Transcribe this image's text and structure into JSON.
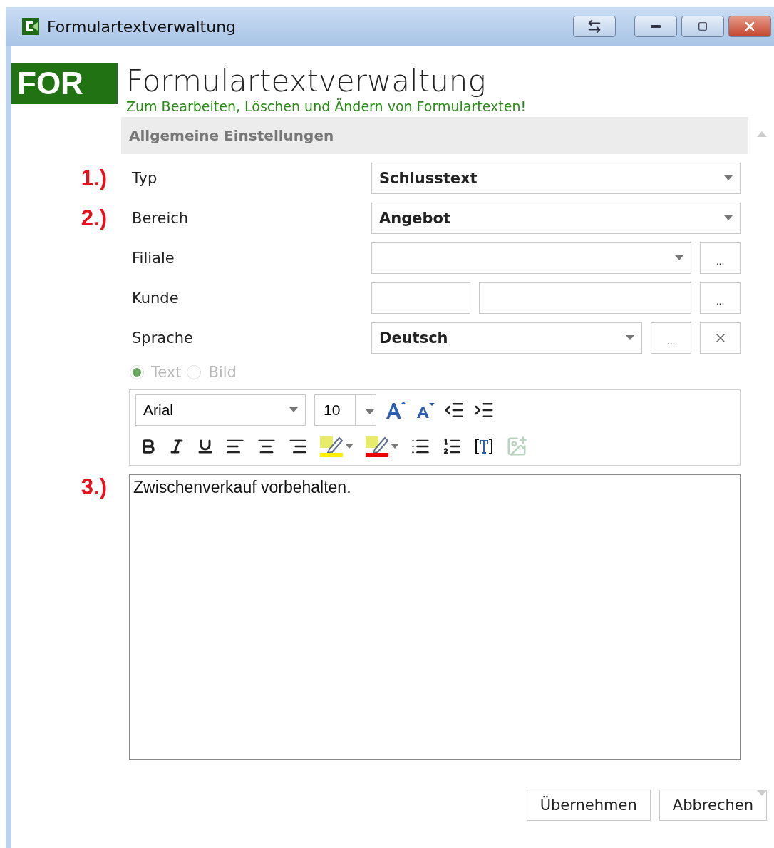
{
  "window": {
    "title": "Formulartextverwaltung"
  },
  "header": {
    "logo": "FOR",
    "title": "Formulartextverwaltung",
    "subtitle": "Zum Bearbeiten, Löschen und Ändern von Formulartexten!"
  },
  "section": {
    "title": "Allgemeine Einstellungen"
  },
  "fields": [
    {
      "kind": "select",
      "marker": "1.)",
      "label": "Typ",
      "value": "Schlusstext"
    },
    {
      "kind": "select",
      "marker": "2.)",
      "label": "Bereich",
      "value": "Angebot"
    },
    {
      "kind": "select-browse",
      "label": "Filiale",
      "browse": "..."
    },
    {
      "kind": "double-browse",
      "label": "Kunde",
      "browse": "..."
    },
    {
      "kind": "select-browse-clear",
      "label": "Sprache",
      "value": "Deutsch",
      "browse": "..."
    }
  ],
  "content_type": [
    {
      "label": "Text",
      "selected": true,
      "disabled": true
    },
    {
      "label": "Bild",
      "selected": false,
      "disabled": true
    }
  ],
  "toolbar": {
    "font": "Arial",
    "size": "10"
  },
  "editor": {
    "marker": "3.)",
    "value": "Zwischenverkauf vorbehalten."
  },
  "buttons": [
    "Übernehmen",
    "Abbrechen"
  ]
}
